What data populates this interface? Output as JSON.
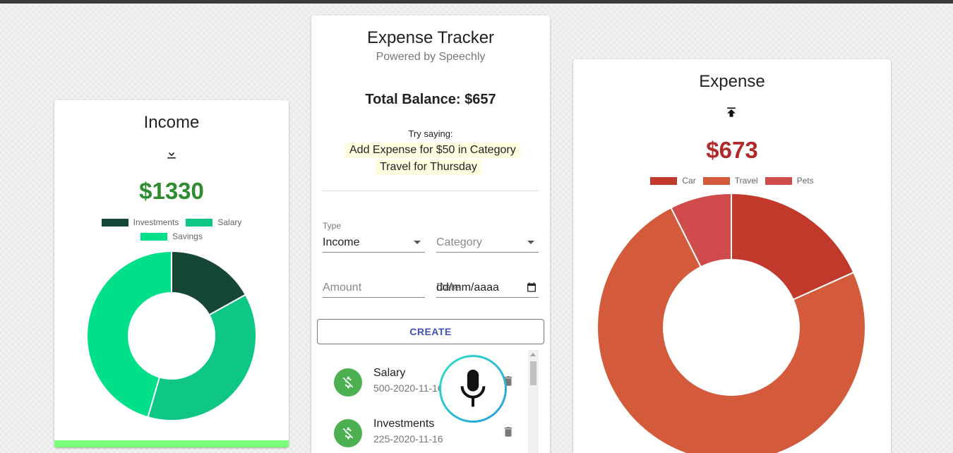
{
  "income": {
    "title": "Income",
    "amount": "$1330",
    "amount_color": "#2e8b2e",
    "icon": "download-icon",
    "legend": [
      {
        "label": "Investments",
        "color": "#154734"
      },
      {
        "label": "Salary",
        "color": "#0fc784"
      },
      {
        "label": "Savings",
        "color": "#00e08a"
      }
    ],
    "chart_data": {
      "type": "pie",
      "categories": [
        "Investments",
        "Salary",
        "Savings"
      ],
      "values": [
        225,
        500,
        605
      ],
      "colors": [
        "#154734",
        "#0fc784",
        "#00e08a"
      ],
      "donut": true
    }
  },
  "center": {
    "title": "Expense Tracker",
    "subtitle": "Powered by Speechly",
    "balance": "Total Balance: $657",
    "try_label": "Try saying:",
    "try_line1": "Add Expense for $50 in Category",
    "try_line2": "Travel for Thursday",
    "form": {
      "type_label": "Type",
      "type_value": "Income",
      "category_placeholder": "Category",
      "amount_placeholder": "Amount",
      "date_label": "Date",
      "date_value": "dd/mm/aaaa"
    },
    "create_label": "CREATE",
    "transactions": [
      {
        "title": "Salary",
        "subtitle": "500-2020-11-16"
      },
      {
        "title": "Investments",
        "subtitle": "225-2020-11-16"
      }
    ]
  },
  "expense": {
    "title": "Expense",
    "amount": "$673",
    "amount_color": "#b02a2a",
    "icon": "upload-icon",
    "legend": [
      {
        "label": "Car",
        "color": "#c0392b"
      },
      {
        "label": "Travel",
        "color": "#d35b3c"
      },
      {
        "label": "Pets",
        "color": "#d04b4b"
      }
    ],
    "chart_data": {
      "type": "pie",
      "categories": [
        "Car",
        "Travel",
        "Pets"
      ],
      "values": [
        123,
        500,
        50
      ],
      "colors": [
        "#c0392b",
        "#d35b3c",
        "#d04b4b"
      ],
      "donut": true
    }
  }
}
